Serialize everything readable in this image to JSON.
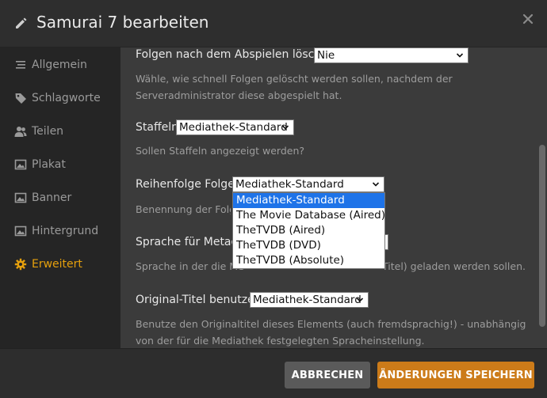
{
  "header": {
    "title": "Samurai 7 bearbeiten"
  },
  "sidebar": {
    "items": [
      {
        "label": "Allgemein",
        "icon": "list-icon"
      },
      {
        "label": "Schlagworte",
        "icon": "tag-icon"
      },
      {
        "label": "Teilen",
        "icon": "users-icon"
      },
      {
        "label": "Plakat",
        "icon": "image-icon"
      },
      {
        "label": "Banner",
        "icon": "image-icon"
      },
      {
        "label": "Hintergrund",
        "icon": "image-icon"
      },
      {
        "label": "Erweitert",
        "icon": "gear-icon",
        "active": true
      }
    ]
  },
  "settings": {
    "delete_after": {
      "label": "Folgen nach dem Abspielen löschen",
      "value": "Nie",
      "description": "Wähle, wie schnell Folgen gelöscht werden sollen, nachdem der Serveradministrator diese abgespielt hat."
    },
    "seasons": {
      "label": "Staffeln",
      "value": "Mediathek-Standard",
      "description": "Sollen Staffeln angezeigt werden?"
    },
    "episode_order": {
      "label": "Reihenfolge Folgen",
      "value": "Mediathek-Standard",
      "description_visible": "Benennung der Folge",
      "options": [
        "Mediathek-Standard",
        "The Movie Database (Aired)",
        "TheTVDB (Aired)",
        "TheTVDB (DVD)",
        "TheTVDB (Absolute)"
      ]
    },
    "metadata_language": {
      "label_visible": "Sprache für Metada",
      "description_left": "Sprache in der die Me",
      "description_right": "Titel) geladen werden sollen."
    },
    "original_title": {
      "label": "Original-Titel benutzen",
      "value": "Mediathek-Standard",
      "description": "Benutze den Originaltitel dieses Elements (auch fremdsprachig!) - unabhängig von der für die Mediathek festgelegten Spracheinstellung."
    }
  },
  "footer": {
    "cancel_label": "ABBRECHEN",
    "save_label": "ÄNDERUNGEN SPEICHERN"
  },
  "colors": {
    "accent": "#e5a00d",
    "save_button": "#cc7b19",
    "selected_option": "#1e73e8"
  }
}
